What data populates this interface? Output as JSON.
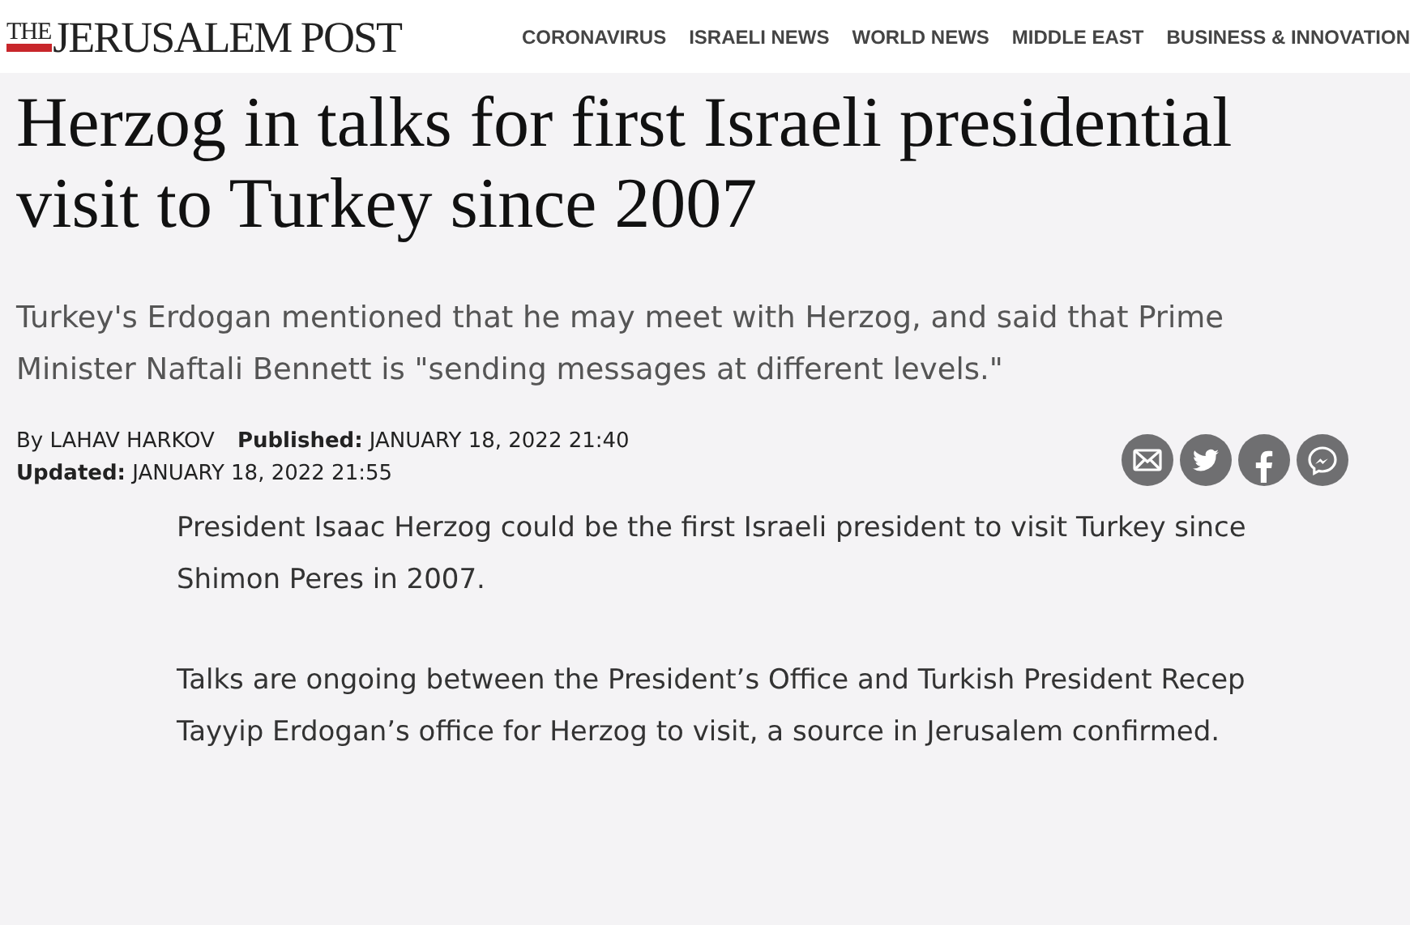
{
  "logo": {
    "small": "THE",
    "main": "JERUSALEM POST"
  },
  "nav": [
    "CORONAVIRUS",
    "ISRAELI NEWS",
    "WORLD NEWS",
    "MIDDLE EAST",
    "BUSINESS & INNOVATION"
  ],
  "headline": "Herzog in talks for first Israeli presidential visit to Turkey since 2007",
  "subheadline": "Turkey's Erdogan mentioned that he may meet with Herzog, and said that Prime Minister Naftali Bennett is \"sending messages at different levels.\"",
  "byline": {
    "author": "By LAHAV HARKOV",
    "published": "**Published:** JANUARY 18, 2022 21:40",
    "updated": "**Updated:** JANUARY 18, 2022 21:55"
  },
  "share": [
    {
      "kind": "email"
    },
    {
      "kind": "twitter"
    },
    {
      "kind": "facebook"
    },
    {
      "kind": "messenger"
    }
  ],
  "paragraphs": [
    "President Isaac Herzog could be the first Israeli president to visit Turkey since Shimon Peres in 2007.",
    "Talks are ongoing between the President’s Office and Turkish President Recep Tayyip Erdogan’s office for Herzog to visit, a source in Jerusalem confirmed."
  ]
}
